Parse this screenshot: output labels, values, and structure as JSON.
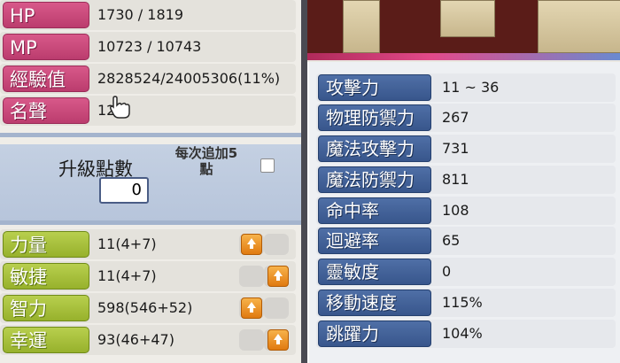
{
  "status": {
    "hp": {
      "label": "HP",
      "value": "1730 / 1819"
    },
    "mp": {
      "label": "MP",
      "value": "10723 / 10743"
    },
    "exp": {
      "label": "經驗值",
      "value": "2828524/24005306(11%)"
    },
    "fame": {
      "label": "名聲",
      "value": "12"
    }
  },
  "level_points": {
    "title": "升級點數",
    "value": "0",
    "increment_label": "每次追加5\n點"
  },
  "stats": [
    {
      "label": "力量",
      "value": "11(4+7)",
      "button_pos": "left"
    },
    {
      "label": "敏捷",
      "value": "11(4+7)",
      "button_pos": "right"
    },
    {
      "label": "智力",
      "value": "598(546+52)",
      "button_pos": "left"
    },
    {
      "label": "幸運",
      "value": "93(46+47)",
      "button_pos": "right"
    }
  ],
  "combat": [
    {
      "label": "攻擊力",
      "value": "11 ~ 36"
    },
    {
      "label": "物理防禦力",
      "value": "267"
    },
    {
      "label": "魔法攻擊力",
      "value": "731"
    },
    {
      "label": "魔法防禦力",
      "value": "811"
    },
    {
      "label": "命中率",
      "value": "108"
    },
    {
      "label": "迴避率",
      "value": "65"
    },
    {
      "label": "靈敏度",
      "value": "0"
    },
    {
      "label": "移動速度",
      "value": "115%"
    },
    {
      "label": "跳躍力",
      "value": "104%"
    }
  ],
  "colors": {
    "status_label": "#c8467a",
    "stat_label": "#a6bf36",
    "combat_label": "#4565a0",
    "plus_button": "#ee9220"
  }
}
